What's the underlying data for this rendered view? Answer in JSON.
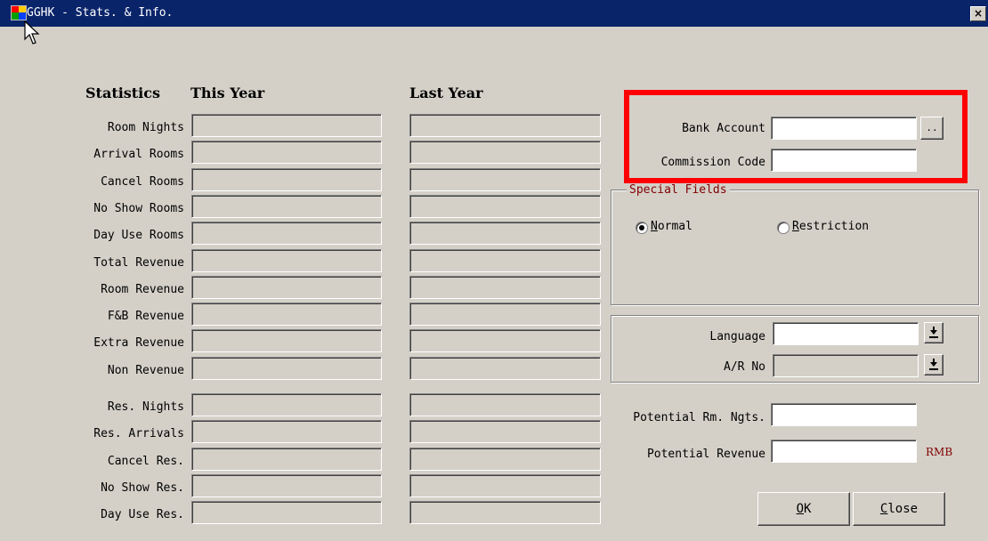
{
  "window": {
    "title": "GGHK - Stats. & Info.",
    "close_glyph": "×"
  },
  "stats": {
    "header_statistics": "Statistics",
    "header_this_year": "This Year",
    "header_last_year": "Last Year",
    "rows": [
      {
        "label": "Room Nights"
      },
      {
        "label": "Arrival Rooms"
      },
      {
        "label": "Cancel Rooms"
      },
      {
        "label": "No Show Rooms"
      },
      {
        "label": "Day Use Rooms"
      },
      {
        "label": "Total Revenue"
      },
      {
        "label": "Room Revenue"
      },
      {
        "label": "F&B Revenue"
      },
      {
        "label": "Extra Revenue"
      },
      {
        "label": "Non Revenue"
      },
      {
        "label": "Res. Nights"
      },
      {
        "label": "Res. Arrivals"
      },
      {
        "label": "Cancel Res."
      },
      {
        "label": "No Show Res."
      },
      {
        "label": "Day Use Res."
      }
    ]
  },
  "bank": {
    "bank_account_label": "Bank Account",
    "bank_account_value": "",
    "browse_label": "..",
    "commission_code_label": "Commission Code",
    "commission_code_value": ""
  },
  "special_fields": {
    "title": "Special Fields",
    "normal_rest": "ormal",
    "normal_mnemonic": "N",
    "restriction_rest": "estriction",
    "restriction_mnemonic": "R",
    "selected": "Normal"
  },
  "misc": {
    "language_label": "Language",
    "language_value": "",
    "ar_no_label": "A/R No",
    "ar_no_value": "",
    "potential_rm_ngts_label": "Potential Rm. Ngts.",
    "potential_rm_ngts_value": "",
    "potential_revenue_label": "Potential Revenue",
    "potential_revenue_value": "",
    "currency": "RMB"
  },
  "buttons": {
    "ok_mnemonic": "O",
    "ok_rest": "K",
    "close_mnemonic": "C",
    "close_rest": "lose"
  },
  "colors": {
    "title_bar": "#0a246a",
    "dialog_bg": "#d4d0c8",
    "highlight_box": "#ff0000",
    "group_title": "#800000",
    "currency": "#800000"
  }
}
